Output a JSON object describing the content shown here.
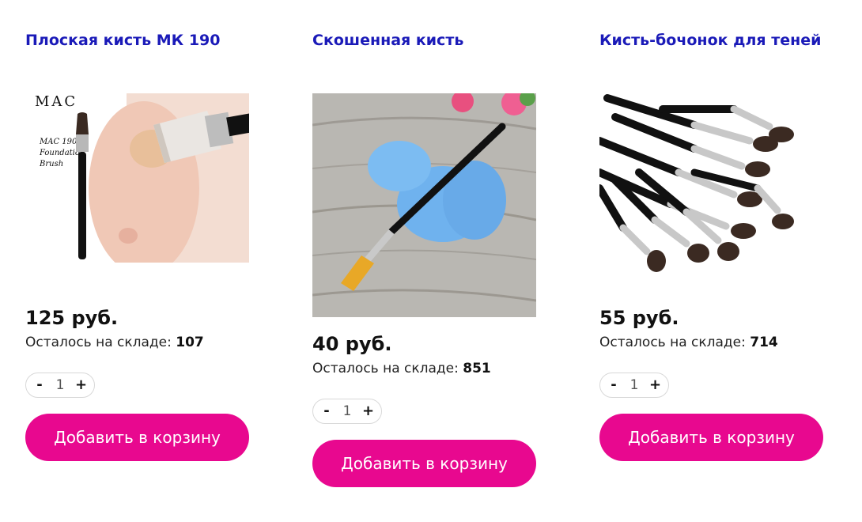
{
  "currency_suffix": "руб.",
  "stock_label": "Осталось на складе:",
  "products": [
    {
      "title": "Плоская кисть МК 190",
      "price": "125 руб.",
      "stock_label": "Осталось на складе:",
      "stock": "107",
      "qty": "1",
      "qty_minus": "-",
      "qty_plus": "+",
      "add_label": "Добавить в корзину",
      "image_icon": "mac-foundation-brush-image",
      "image_text": [
        "MAC 190",
        "Foundation",
        "Brush"
      ]
    },
    {
      "title": "Скошенная кисть",
      "price": "40 руб.",
      "stock_label": "Осталось на складе:",
      "stock": "851",
      "qty": "1",
      "qty_minus": "-",
      "qty_plus": "+",
      "add_label": "Добавить в корзину",
      "image_icon": "angled-brush-with-sponge-image"
    },
    {
      "title": "Кисть-бочонок для теней",
      "price": "55 руб.",
      "stock_label": "Осталось на складе:",
      "stock": "714",
      "qty": "1",
      "qty_minus": "-",
      "qty_plus": "+",
      "add_label": "Добавить в корзину",
      "image_icon": "eyeshadow-brushes-image"
    }
  ],
  "colors": {
    "title_link": "#1a1ab8",
    "button_bg": "#e8088f",
    "button_text": "#ffffff"
  }
}
